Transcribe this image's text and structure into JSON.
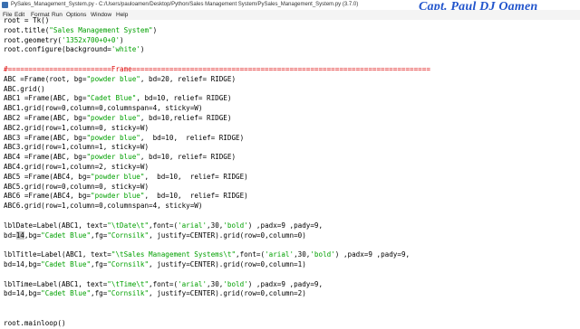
{
  "window": {
    "title": "PySales_Management_System.py - C:/Users/paulo​amen/Desktop/Python/Sales Management System/PySales_Management_System.py (3.7.0)",
    "watermark": "Capt. Paul DJ Oamen"
  },
  "menu": [
    "File",
    "Edit",
    "Format",
    "Run",
    "Options",
    "Window",
    "Help"
  ],
  "code_lines": [
    [
      {
        "t": "root = Tk()"
      }
    ],
    [
      {
        "t": "root.title("
      },
      {
        "t": "\"Sales Management System\"",
        "c": "str"
      },
      {
        "t": ")"
      }
    ],
    [
      {
        "t": "root.geometry("
      },
      {
        "t": "'1352x700+0+0'",
        "c": "str"
      },
      {
        "t": ")"
      }
    ],
    [
      {
        "t": "root.configure(background="
      },
      {
        "t": "'white'",
        "c": "str"
      },
      {
        "t": ")"
      }
    ],
    [
      {
        "t": ""
      }
    ],
    [
      {
        "t": "#=========================Frame========================================================================",
        "c": "com"
      }
    ],
    [
      {
        "t": "ABC =Frame(root, bg="
      },
      {
        "t": "\"powder blue\"",
        "c": "str"
      },
      {
        "t": ", bd=20, relief= RIDGE)"
      }
    ],
    [
      {
        "t": "ABC.grid()"
      }
    ],
    [
      {
        "t": "ABC1 =Frame(ABC, bg="
      },
      {
        "t": "\"Cadet Blue\"",
        "c": "str"
      },
      {
        "t": ", bd=10, relief= RIDGE)"
      }
    ],
    [
      {
        "t": "ABC1.grid(row=0,column=0,columnspan=4, sticky=W)"
      }
    ],
    [
      {
        "t": "ABC2 =Frame(ABC, bg="
      },
      {
        "t": "\"powder blue\"",
        "c": "str"
      },
      {
        "t": ", bd=10,relief= RIDGE)"
      }
    ],
    [
      {
        "t": "ABC2.grid(row=1,column=0, sticky=W)"
      }
    ],
    [
      {
        "t": "ABC3 =Frame(ABC, bg="
      },
      {
        "t": "\"powder blue\"",
        "c": "str"
      },
      {
        "t": ",  bd=10,  relief= RIDGE)"
      }
    ],
    [
      {
        "t": "ABC3.grid(row=1,column=1, sticky=W)"
      }
    ],
    [
      {
        "t": "ABC4 =Frame(ABC, bg="
      },
      {
        "t": "\"powder blue\"",
        "c": "str"
      },
      {
        "t": ", bd=10, relief= RIDGE)"
      }
    ],
    [
      {
        "t": "ABC4.grid(row=1,column=2, sticky=W)"
      }
    ],
    [
      {
        "t": "ABC5 =Frame(ABC4, bg="
      },
      {
        "t": "\"powder blue\"",
        "c": "str"
      },
      {
        "t": ",  bd=10,  relief= RIDGE)"
      }
    ],
    [
      {
        "t": "ABC5.grid(row=0,column=0, sticky=W)"
      }
    ],
    [
      {
        "t": "ABC6 =Frame(ABC4, bg="
      },
      {
        "t": "\"powder blue\"",
        "c": "str"
      },
      {
        "t": ",  bd=10,  relief= RIDGE)"
      }
    ],
    [
      {
        "t": "ABC6.grid(row=1,column=0,columnspan=4, sticky=W)"
      }
    ],
    [
      {
        "t": ""
      }
    ],
    [
      {
        "t": "lblDate=Label(ABC1, text="
      },
      {
        "t": "\"\\tDate\\t\"",
        "c": "str"
      },
      {
        "t": ",font=("
      },
      {
        "t": "'arial'",
        "c": "str"
      },
      {
        "t": ",30,"
      },
      {
        "t": "'bold'",
        "c": "str"
      },
      {
        "t": ") ,padx=9 ,pady=9,"
      }
    ],
    [
      {
        "t": "bd="
      },
      {
        "t": "14",
        "c": "sel"
      },
      {
        "t": ",bg="
      },
      {
        "t": "\"Cadet Blue\"",
        "c": "str"
      },
      {
        "t": ",fg="
      },
      {
        "t": "\"Cornsilk\"",
        "c": "str"
      },
      {
        "t": ", justify=CENTER).grid(row=0,column=0)"
      }
    ],
    [
      {
        "t": ""
      }
    ],
    [
      {
        "t": "lblTitle=Label(ABC1, text="
      },
      {
        "t": "\"\\tSales Management Systems\\t\"",
        "c": "str"
      },
      {
        "t": ",font=("
      },
      {
        "t": "'arial'",
        "c": "str"
      },
      {
        "t": ",30,"
      },
      {
        "t": "'bold'",
        "c": "str"
      },
      {
        "t": ") ,padx=9 ,pady=9,"
      }
    ],
    [
      {
        "t": "bd=14,bg="
      },
      {
        "t": "\"Cadet Blue\"",
        "c": "str"
      },
      {
        "t": ",fg="
      },
      {
        "t": "\"Cornsilk\"",
        "c": "str"
      },
      {
        "t": ", justify=CENTER).grid(row=0,column=1)"
      }
    ],
    [
      {
        "t": ""
      }
    ],
    [
      {
        "t": "lblTime=Label(ABC1, text="
      },
      {
        "t": "\"\\tTime\\t\"",
        "c": "str"
      },
      {
        "t": ",font=("
      },
      {
        "t": "'arial'",
        "c": "str"
      },
      {
        "t": ",30,"
      },
      {
        "t": "'bold'",
        "c": "str"
      },
      {
        "t": ") ,padx=9 ,pady=9,"
      }
    ],
    [
      {
        "t": "bd=14,bg="
      },
      {
        "t": "\"Cadet Blue\"",
        "c": "str"
      },
      {
        "t": ",fg="
      },
      {
        "t": "\"Cornsilk\"",
        "c": "str"
      },
      {
        "t": ", justify=CENTER).grid(row=0,column=2)"
      }
    ],
    [
      {
        "t": ""
      }
    ],
    [
      {
        "t": ""
      }
    ],
    [
      {
        "t": "root.mainloop()"
      }
    ]
  ]
}
